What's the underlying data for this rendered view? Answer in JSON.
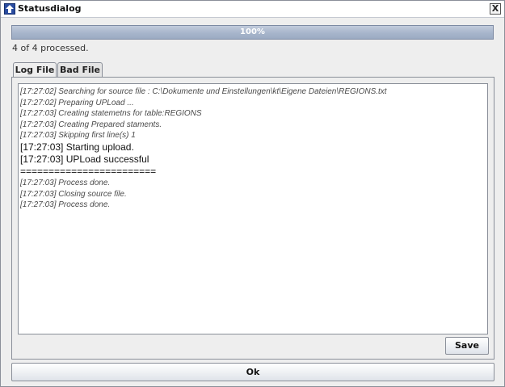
{
  "window": {
    "title": "Statusdialog",
    "close_label": "X"
  },
  "progress": {
    "text": "100%",
    "fraction": 1.0,
    "processed_text": "4 of 4 processed."
  },
  "tabs": [
    {
      "label": "Log File",
      "active": true
    },
    {
      "label": "Bad File",
      "active": false
    }
  ],
  "log": {
    "lines": [
      {
        "text": "[17:27:02] Searching for source file : C:\\Dokumente und Einstellungen\\kt\\Eigene Dateien\\REGIONS.txt",
        "style": "small"
      },
      {
        "text": "[17:27:02] Preparing UPLoad ...",
        "style": "small"
      },
      {
        "text": "[17:27:03] Creating statemetns for table:REGIONS",
        "style": "small"
      },
      {
        "text": "[17:27:03] Creating Prepared staments.",
        "style": "small"
      },
      {
        "text": "[17:27:03] Skipping first line(s) 1",
        "style": "small"
      },
      {
        "text": "[17:27:03] Starting upload.",
        "style": "big"
      },
      {
        "text": "[17:27:03] UPLoad successful",
        "style": "big"
      },
      {
        "text": "========================",
        "style": "big"
      },
      {
        "text": "[17:27:03] Process done.",
        "style": "small"
      },
      {
        "text": "[17:27:03] Closing source file.",
        "style": "small"
      },
      {
        "text": "[17:27:03] Process done.",
        "style": "small"
      }
    ]
  },
  "buttons": {
    "save_label": "Save",
    "ok_label": "Ok"
  }
}
